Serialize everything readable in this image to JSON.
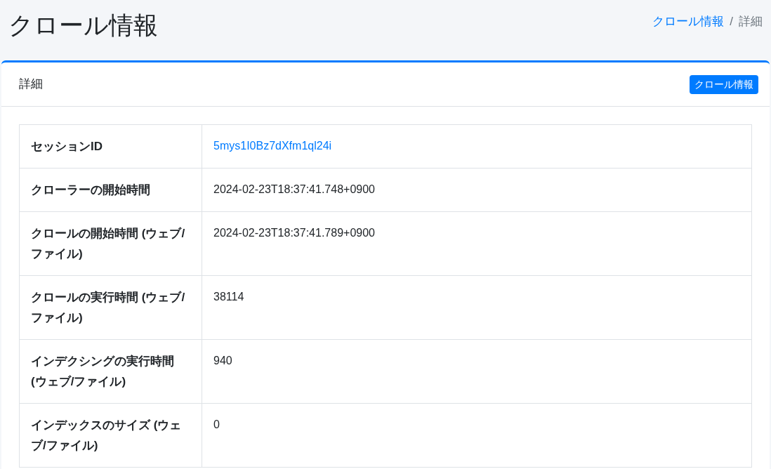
{
  "page_title": "クロール情報",
  "breadcrumb_separator": "/",
  "breadcrumb": [
    {
      "label": "クロール情報",
      "kind": "link"
    },
    {
      "label": "詳細",
      "kind": "current"
    }
  ],
  "card": {
    "title": "詳細",
    "button": "クロール情報"
  },
  "rows": [
    {
      "label": "セッションID",
      "value": "5mys1I0Bz7dXfm1ql24i",
      "kind": "link"
    },
    {
      "label": "クローラーの開始時間",
      "value": "2024-02-23T18:37:41.748+0900",
      "kind": "text"
    },
    {
      "label": "クロールの開始時間 (ウェブ/ファイル)",
      "value": "2024-02-23T18:37:41.789+0900",
      "kind": "text"
    },
    {
      "label": "クロールの実行時間 (ウェブ/ファイル)",
      "value": "38114",
      "kind": "text"
    },
    {
      "label": "インデクシングの実行時間 (ウェブ/ファイル)",
      "value": "940",
      "kind": "text"
    },
    {
      "label": "インデックスのサイズ (ウェブ/ファイル)",
      "value": "0",
      "kind": "text"
    }
  ]
}
